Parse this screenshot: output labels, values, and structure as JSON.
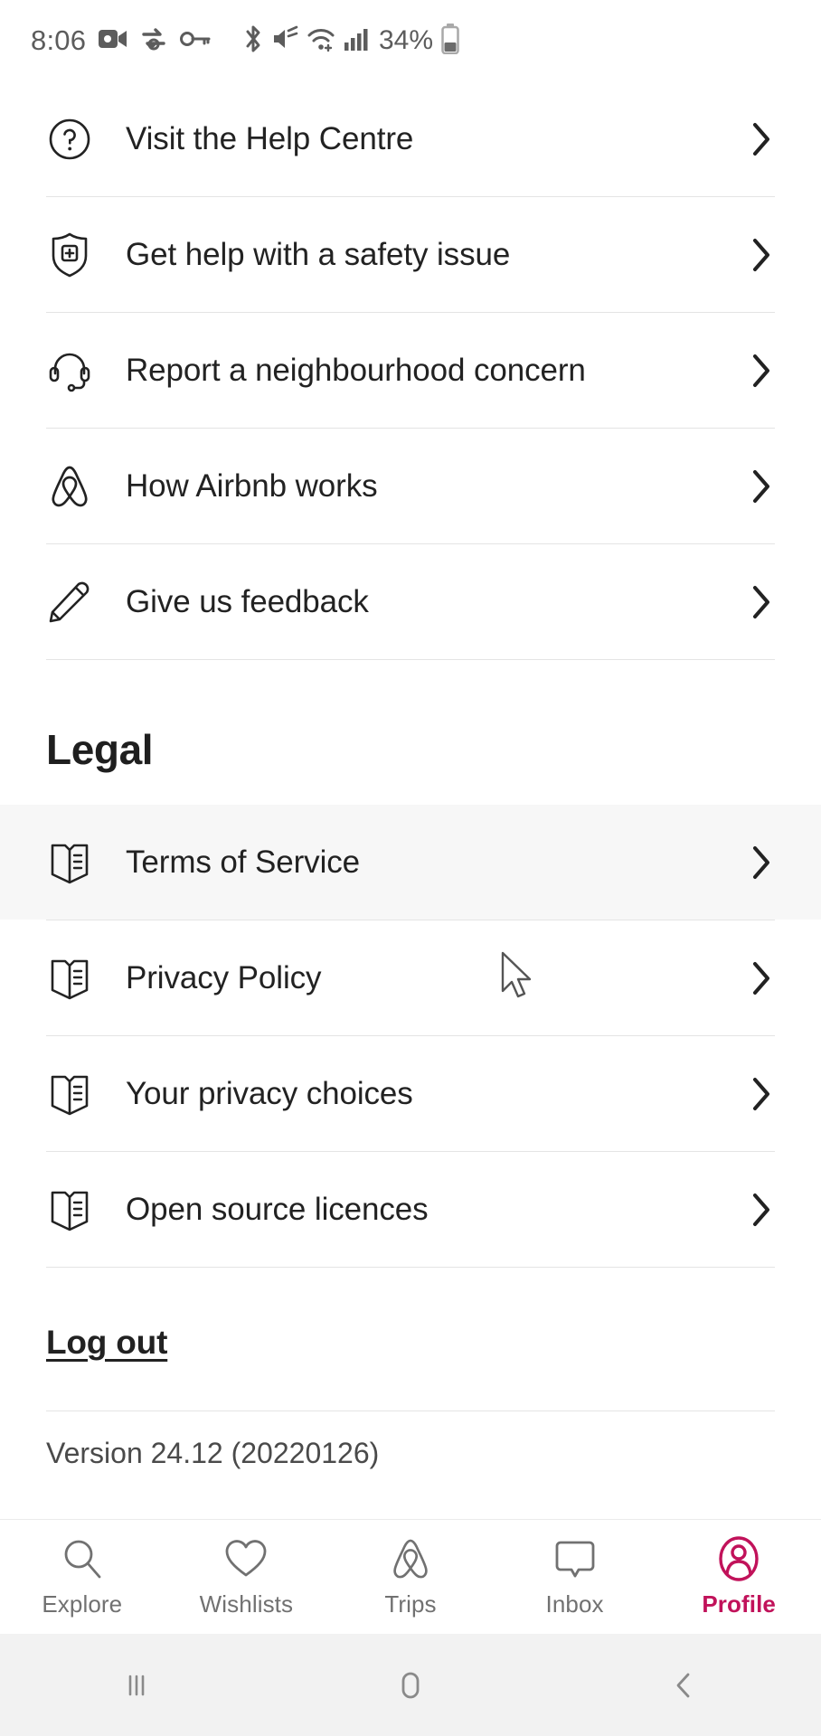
{
  "status_bar": {
    "time": "8:06",
    "battery_percent": "34%",
    "left_icons": [
      "video-camera-icon",
      "sync-icon",
      "vpn-key-icon"
    ],
    "right_icons": [
      "bluetooth-icon",
      "volume-muted-icon",
      "wifi-icon",
      "cellular-signal-icon",
      "battery-icon"
    ]
  },
  "help_section": {
    "items": [
      {
        "label": "Visit the Help Centre",
        "icon": "question-circle-icon"
      },
      {
        "label": "Get help with a safety issue",
        "icon": "shield-plus-icon"
      },
      {
        "label": "Report a neighbourhood concern",
        "icon": "headset-icon"
      },
      {
        "label": "How Airbnb works",
        "icon": "airbnb-belo-icon"
      },
      {
        "label": "Give us feedback",
        "icon": "pencil-icon"
      }
    ]
  },
  "legal_section": {
    "heading": "Legal",
    "items": [
      {
        "label": "Terms of Service",
        "icon": "document-icon",
        "hovered": true
      },
      {
        "label": "Privacy Policy",
        "icon": "document-icon",
        "hovered": false
      },
      {
        "label": "Your privacy choices",
        "icon": "document-icon",
        "hovered": false
      },
      {
        "label": "Open source licences",
        "icon": "document-icon",
        "hovered": false
      }
    ]
  },
  "account": {
    "logout_label": "Log out",
    "version_text": "Version 24.12 (20220126)"
  },
  "bottom_nav": {
    "active": "Profile",
    "items": [
      {
        "label": "Explore",
        "icon": "search-icon"
      },
      {
        "label": "Wishlists",
        "icon": "heart-icon"
      },
      {
        "label": "Trips",
        "icon": "airbnb-belo-icon"
      },
      {
        "label": "Inbox",
        "icon": "speech-bubble-icon"
      },
      {
        "label": "Profile",
        "icon": "profile-circle-icon"
      }
    ]
  },
  "android_nav": {
    "buttons": [
      "recents-icon",
      "home-icon",
      "back-icon"
    ]
  },
  "colors": {
    "accent": "#C1125A",
    "text_primary": "#222222",
    "text_muted": "#717171",
    "divider": "#e4e4e4",
    "hover_bg": "#f7f7f7"
  }
}
